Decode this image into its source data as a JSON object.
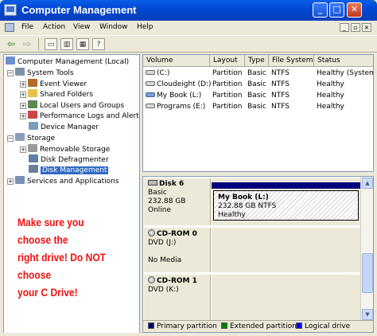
{
  "window": {
    "title": "Computer Management",
    "min": "_",
    "max": "□",
    "close": "✕"
  },
  "menu": {
    "items": [
      "File",
      "Action",
      "View",
      "Window",
      "Help"
    ]
  },
  "tree": [
    {
      "label": "Computer Management (Local)",
      "icon": "computer-icon"
    },
    {
      "label": "System Tools",
      "icon": "toolbox-icon"
    },
    {
      "label": "Event Viewer",
      "icon": "event-viewer-icon"
    },
    {
      "label": "Shared Folders",
      "icon": "shared-folders-icon"
    },
    {
      "label": "Local Users and Groups",
      "icon": "users-icon"
    },
    {
      "label": "Performance Logs and Alerts",
      "icon": "performance-icon"
    },
    {
      "label": "Device Manager",
      "icon": "device-manager-icon"
    },
    {
      "label": "Storage",
      "icon": "storage-icon"
    },
    {
      "label": "Removable Storage",
      "icon": "removable-storage-icon"
    },
    {
      "label": "Disk Defragmenter",
      "icon": "defrag-icon"
    },
    {
      "label": "Disk Management",
      "icon": "disk-management-icon"
    },
    {
      "label": "Services and Applications",
      "icon": "services-icon"
    }
  ],
  "overlay_text": [
    "Make sure you choose the",
    "right drive! Do NOT choose",
    "your C Drive!"
  ],
  "volumes": {
    "columns": [
      "Volume",
      "Layout",
      "Type",
      "File System",
      "Status"
    ],
    "rows": [
      [
        "(C:)",
        "Partition",
        "Basic",
        "NTFS",
        "Healthy (System)"
      ],
      [
        "Cloudeight (D:)",
        "Partition",
        "Basic",
        "NTFS",
        "Healthy"
      ],
      [
        "My Book (L:)",
        "Partition",
        "Basic",
        "NTFS",
        "Healthy"
      ],
      [
        "Programs (E:)",
        "Partition",
        "Basic",
        "NTFS",
        "Healthy"
      ]
    ]
  },
  "disks": [
    {
      "name": "Disk 6",
      "lines": [
        "Basic",
        "232.88 GB",
        "Online"
      ],
      "partition": {
        "name": "My Book  (L:)",
        "detail": "232.88 GB NTFS",
        "status": "Healthy"
      }
    },
    {
      "name": "CD-ROM 0",
      "lines": [
        "DVD (J:)",
        "",
        "No Media"
      ]
    },
    {
      "name": "CD-ROM 1",
      "lines": [
        "DVD (K:)"
      ]
    }
  ],
  "legend": [
    {
      "label": "Primary partition",
      "color": "#00007e"
    },
    {
      "label": "Extended partition",
      "color": "#008000"
    },
    {
      "label": "Logical drive",
      "color": "#0000ff"
    }
  ]
}
